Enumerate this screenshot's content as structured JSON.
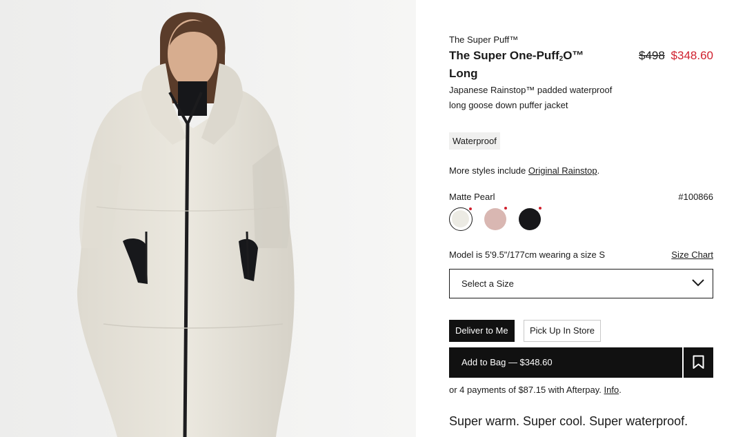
{
  "product": {
    "eyebrow": "The Super Puff™",
    "title_main": "The Super One-Puff",
    "title_sub": "2",
    "title_end": "O™",
    "title_line2": "Long",
    "price_original": "$498",
    "price_sale": "$348.60",
    "description": "Japanese Rainstop™ padded waterproof long goose down puffer jacket",
    "badge": "Waterproof",
    "more_styles_prefix": "More styles include ",
    "more_styles_link": "Original Rainstop",
    "more_styles_suffix": "."
  },
  "color": {
    "selected_name": "Matte Pearl",
    "style_number": "#100866",
    "swatches": [
      {
        "name": "Matte Pearl",
        "hex": "#ecebe4",
        "selected": true,
        "sale_dot": true
      },
      {
        "name": "Pink",
        "hex": "#d9b7b2",
        "selected": false,
        "sale_dot": true
      },
      {
        "name": "Black",
        "hex": "#17171a",
        "selected": false,
        "sale_dot": true
      }
    ]
  },
  "size": {
    "model_info": "Model is 5'9.5\"/177cm wearing a size S",
    "size_chart_label": "Size Chart",
    "select_placeholder": "Select a Size"
  },
  "fulfillment": {
    "deliver_label": "Deliver to Me",
    "pickup_label": "Pick Up In Store",
    "active": "deliver"
  },
  "cart": {
    "add_to_bag_label": "Add to Bag — $348.60"
  },
  "afterpay": {
    "text": "or 4 payments of $87.15 with Afterpay. ",
    "link": "Info",
    "suffix": "."
  },
  "tagline": "Super warm. Super cool. Super waterproof.",
  "colors": {
    "sale_red": "#d0202e",
    "primary_black": "#111111",
    "badge_bg": "#f0f0ef"
  },
  "icons": {
    "dropdown": "chevron-down-icon",
    "wishlist": "bookmark-icon"
  }
}
